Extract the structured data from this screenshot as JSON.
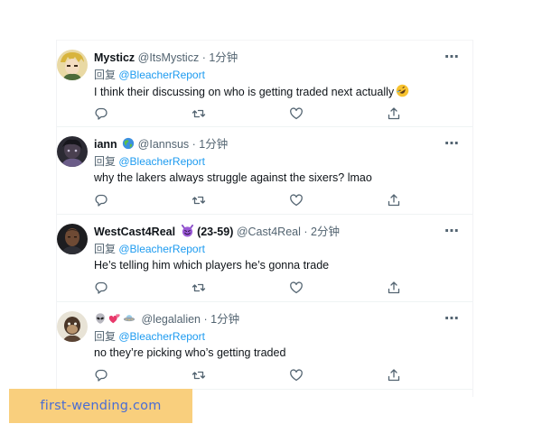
{
  "replies": [
    {
      "display_name": "Mysticz",
      "handle": "@ItsMysticz",
      "separator": "·",
      "time": "1分钟",
      "reply_prefix": "回复",
      "reply_to": "@BleacherReport",
      "text": "I think their discussing on who is getting traded next actually",
      "text_emoji": "rolling-on-floor-laughing-emoji",
      "avatar": "anime-character-avatar",
      "more_icon": "⋯"
    },
    {
      "display_name": "iann",
      "name_emoji": "globe-emoji",
      "handle": "@Iannsus",
      "separator": "·",
      "time": "1分钟",
      "reply_prefix": "回复",
      "reply_to": "@BleacherReport",
      "text": "why the lakers always struggle against the sixers? lmao",
      "avatar": "dark-character-avatar",
      "more_icon": "⋯"
    },
    {
      "display_name": "WestCast4Real",
      "name_emoji": "smiling-devil-emoji",
      "record": "(23-59)",
      "handle": "@Cast4Real",
      "separator": "·",
      "time": "2分钟",
      "reply_prefix": "回复",
      "reply_to": "@BleacherReport",
      "text": "He’s telling him which players he’s gonna trade",
      "avatar": "person-photo-avatar",
      "more_icon": "⋯"
    },
    {
      "display_name_emojis": [
        "alien-emoji",
        "two-hearts-emoji",
        "flying-saucer-emoji"
      ],
      "handle": "@legalalien",
      "separator": "·",
      "time": "1分钟",
      "reply_prefix": "回复",
      "reply_to": "@BleacherReport",
      "text": "no they’re picking who’s getting traded",
      "avatar": "ape-nft-avatar",
      "more_icon": "⋯"
    }
  ],
  "action_icons": [
    "reply-icon",
    "retweet-icon",
    "like-icon",
    "share-icon"
  ],
  "watermark": "first-wending.com",
  "colors": {
    "link": "#1d9bf0",
    "secondary_text": "#536471",
    "primary_text": "#0f1419",
    "watermark_bg": "#f9cf7d",
    "watermark_text": "#4a6dd4"
  }
}
